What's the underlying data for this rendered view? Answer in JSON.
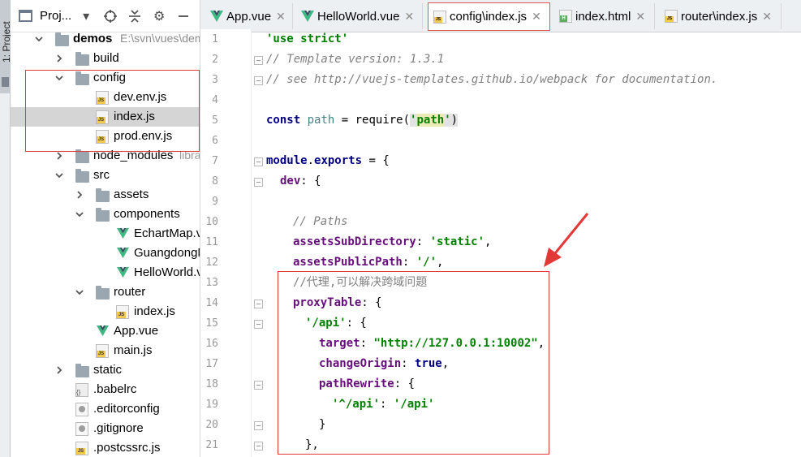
{
  "side_strip": {
    "label": "1: Project"
  },
  "project_panel": {
    "title": "Proj...",
    "toolbar_icons": [
      "dropdown-icon",
      "locate-icon",
      "collapse-icon",
      "gear-icon",
      "hide-icon"
    ],
    "tree": [
      {
        "label": "demos",
        "path": "E:\\svn\\vues\\demos",
        "type": "folder",
        "depth": 0,
        "expanded": true,
        "bold": true
      },
      {
        "label": "build",
        "type": "folder",
        "depth": 1,
        "expanded": false
      },
      {
        "label": "config",
        "type": "folder",
        "depth": 1,
        "expanded": true
      },
      {
        "label": "dev.env.js",
        "type": "js",
        "depth": 2
      },
      {
        "label": "index.js",
        "type": "js",
        "depth": 2,
        "selected": true
      },
      {
        "label": "prod.env.js",
        "type": "js",
        "depth": 2
      },
      {
        "label": "node_modules",
        "hint": "library root",
        "type": "folder",
        "depth": 1,
        "expanded": false
      },
      {
        "label": "src",
        "type": "folder",
        "depth": 1,
        "expanded": true
      },
      {
        "label": "assets",
        "type": "folder",
        "depth": 2,
        "expanded": false
      },
      {
        "label": "components",
        "type": "folder",
        "depth": 2,
        "expanded": true
      },
      {
        "label": "EchartMap.vue",
        "type": "vue",
        "depth": 3
      },
      {
        "label": "GuangdongMap.vue",
        "type": "vue",
        "depth": 3
      },
      {
        "label": "HelloWorld.vue",
        "type": "vue",
        "depth": 3
      },
      {
        "label": "router",
        "type": "folder",
        "depth": 2,
        "expanded": true
      },
      {
        "label": "index.js",
        "type": "js",
        "depth": 3
      },
      {
        "label": "App.vue",
        "type": "vue",
        "depth": 2
      },
      {
        "label": "main.js",
        "type": "js",
        "depth": 2
      },
      {
        "label": "static",
        "type": "folder",
        "depth": 1,
        "expanded": false
      },
      {
        "label": ".babelrc",
        "type": "cfg",
        "depth": 1
      },
      {
        "label": ".editorconfig",
        "type": "editorcfg",
        "depth": 1
      },
      {
        "label": ".gitignore",
        "type": "git",
        "depth": 1
      },
      {
        "label": ".postcssrc.js",
        "type": "js",
        "depth": 1
      }
    ]
  },
  "tabs": [
    {
      "label": "App.vue",
      "icon": "vue-icon",
      "active": false
    },
    {
      "label": "HelloWorld.vue",
      "icon": "vue-icon",
      "active": false
    },
    {
      "label": "config\\index.js",
      "icon": "js-file-icon",
      "active": true
    },
    {
      "label": "index.html",
      "icon": "html-file-icon",
      "active": false
    },
    {
      "label": "router\\index.js",
      "icon": "js-file-icon",
      "active": false
    }
  ],
  "line_numbers": [
    "1",
    "2",
    "3",
    "4",
    "5",
    "6",
    "7",
    "8",
    "9",
    "10",
    "11",
    "12",
    "13",
    "14",
    "15",
    "16",
    "17",
    "18",
    "19",
    "20",
    "21"
  ],
  "code": {
    "l1": "'use strict'",
    "l2": "// Template version: 1.3.1",
    "l3": "// see http://vuejs-templates.github.io/webpack for documentation.",
    "l5_kw": "const",
    "l5_var": "path",
    "l5_eq": " = require(",
    "l5_str_open": "'",
    "l5_str": "path",
    "l5_str_close": "'",
    "l5_end": ")",
    "l7_a": "module",
    "l7_b": ".",
    "l7_c": "exports",
    "l7_d": " = {",
    "l8_prop": "dev",
    "l8_rest": ": {",
    "l10": "// Paths",
    "l11_prop": "assetsSubDirectory",
    "l11_mid": ": ",
    "l11_str": "'static'",
    "l11_end": ",",
    "l12_prop": "assetsPublicPath",
    "l12_mid": ": ",
    "l12_str": "'/'",
    "l12_end": ",",
    "l13": "//代理,可以解决跨域问题",
    "l14_prop": "proxyTable",
    "l14_rest": ": {",
    "l15_str": "'/api'",
    "l15_rest": ": {",
    "l16_prop": "target",
    "l16_mid": ": ",
    "l16_str": "\"http://127.0.0.1:10002\"",
    "l16_end": ",",
    "l17_prop": "changeOrigin",
    "l17_mid": ": ",
    "l17_kw": "true",
    "l17_end": ",",
    "l18_prop": "pathRewrite",
    "l18_rest": ": {",
    "l19_str1": "'^/api'",
    "l19_mid": ": ",
    "l19_str2": "'/api'",
    "l20": "}",
    "l21": "},"
  },
  "colors": {
    "annotation_red": "#e23838",
    "keyword": "#000080",
    "string": "#008000",
    "property": "#660e7a",
    "comment": "#808080"
  }
}
